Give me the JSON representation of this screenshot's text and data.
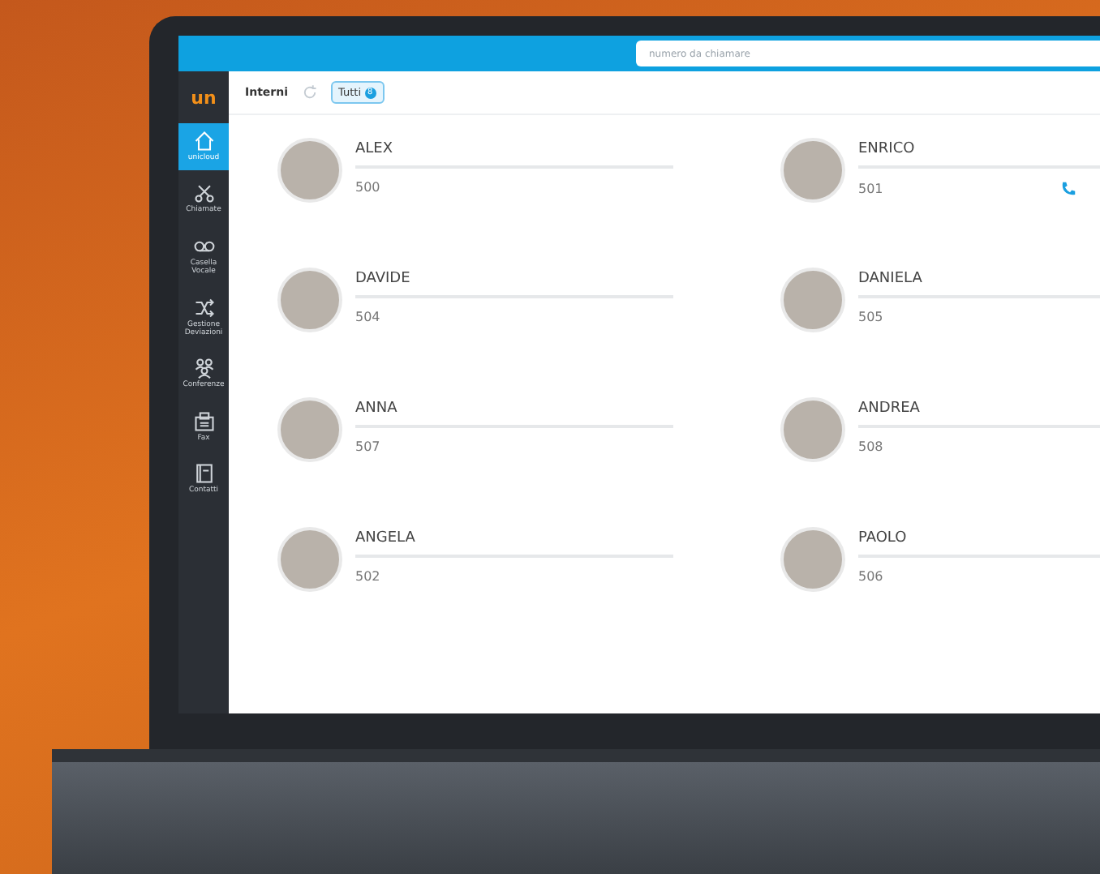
{
  "search": {
    "placeholder": "numero da chiamare"
  },
  "sidebar": {
    "logo": "un",
    "items": [
      {
        "kind": "home",
        "label": "unicloud",
        "selected": true
      },
      {
        "kind": "calls",
        "label": "Chiamate",
        "selected": false
      },
      {
        "kind": "voicemail",
        "label": "Casella Vocale",
        "selected": false
      },
      {
        "kind": "forward",
        "label": "Gestione Deviazioni",
        "selected": false
      },
      {
        "kind": "conference",
        "label": "Conferenze",
        "selected": false
      },
      {
        "kind": "fax",
        "label": "Fax",
        "selected": false
      },
      {
        "kind": "contacts",
        "label": "Contatti",
        "selected": false
      }
    ]
  },
  "toolbar": {
    "title": "Interni",
    "filter": {
      "label": "Tutti",
      "count": "8"
    }
  },
  "contacts": [
    {
      "name": "ALEX",
      "extension": "500",
      "show_actions": false
    },
    {
      "name": "ENRICO",
      "extension": "501",
      "show_actions": true
    },
    {
      "name": "DAVIDE",
      "extension": "504",
      "show_actions": false
    },
    {
      "name": "DANIELA",
      "extension": "505",
      "show_actions": false
    },
    {
      "name": "ANNA",
      "extension": "507",
      "show_actions": false
    },
    {
      "name": "ANDREA",
      "extension": "508",
      "show_actions": false
    },
    {
      "name": "ANGELA",
      "extension": "502",
      "show_actions": false
    },
    {
      "name": "PAOLO",
      "extension": "506",
      "show_actions": false
    }
  ]
}
